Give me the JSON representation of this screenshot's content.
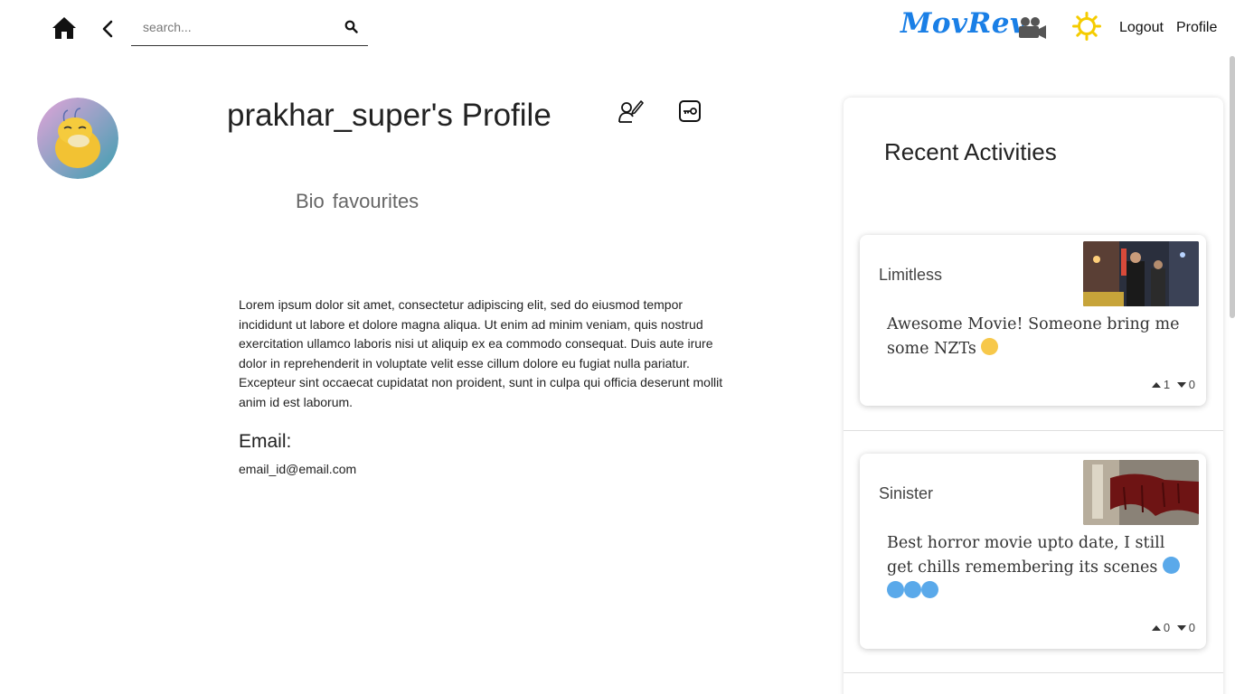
{
  "nav": {
    "search_placeholder": "search...",
    "brand": "MovRev",
    "logout": "Logout",
    "profile": "Profile"
  },
  "profile": {
    "title": "prakhar_super's Profile",
    "tabs": [
      "Bio",
      "favourites"
    ],
    "bio": "Lorem ipsum dolor sit amet, consectetur adipiscing elit, sed do eiusmod tempor incididunt ut labore et dolore magna aliqua. Ut enim ad minim veniam, quis nostrud exercitation ullamco laboris nisi ut aliquip ex ea commodo consequat. Duis aute irure dolor in reprehenderit in voluptate velit esse cillum dolore eu fugiat nulla pariatur. Excepteur sint occaecat cupidatat non proident, sunt in culpa qui officia deserunt mollit anim id est laborum.",
    "email_heading": "Email:",
    "email": "email_id@email.com"
  },
  "activities": {
    "heading": "Recent Activities",
    "items": [
      {
        "movie": "Limitless",
        "review": "Awesome Movie! Someone bring me some NZTs",
        "upvotes": "1",
        "downvotes": "0"
      },
      {
        "movie": "Sinister",
        "review": "Best horror movie upto date, I still get chills remembering its scenes",
        "upvotes": "0",
        "downvotes": "0"
      }
    ]
  },
  "colors": {
    "brand": "#1a7fe6",
    "sun": "#f5cc00"
  },
  "icons": [
    "home-icon",
    "back-icon",
    "search-icon",
    "camera-icon",
    "sun-icon",
    "edit-profile-icon",
    "key-icon",
    "upvote-icon",
    "downvote-icon"
  ]
}
